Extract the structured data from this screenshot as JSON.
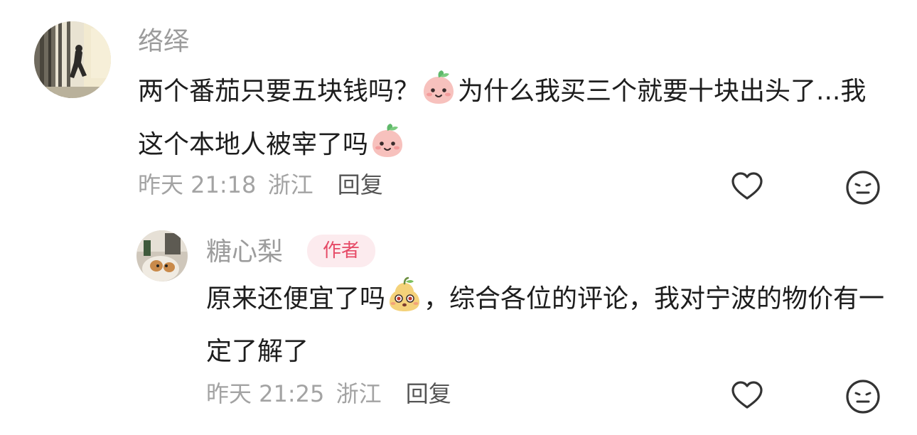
{
  "comments": [
    {
      "username": "络绎",
      "text_parts": [
        "两个番茄只要五块钱吗？",
        "为什么我买三个就要十块出头了...我这个本地人被宰了吗"
      ],
      "time": "昨天 21:18",
      "location": "浙江",
      "reply_label": "回复",
      "emojis": [
        "peach-face-emoji",
        "peach-face-emoji"
      ]
    },
    {
      "username": "糖心梨",
      "badge": "作者",
      "text_parts": [
        "原来还便宜了吗",
        "，综合各位的评论，我对宁波的物价有一定了解了"
      ],
      "time": "昨天 21:25",
      "location": "浙江",
      "reply_label": "回复",
      "emojis": [
        "pear-face-emoji"
      ]
    }
  ],
  "icons": {
    "like": "heart-outline-icon",
    "dislike": "meh-face-icon"
  },
  "colors": {
    "username": "#9c9c9c",
    "text": "#1d1d1d",
    "meta": "#a3a3a3",
    "badge_bg": "#fcebee",
    "badge_text": "#e64a66"
  }
}
